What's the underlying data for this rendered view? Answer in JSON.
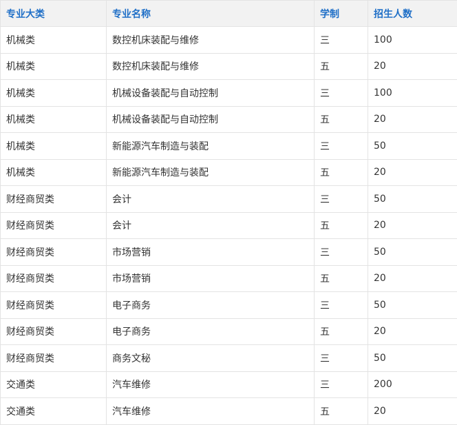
{
  "table": {
    "headers": [
      "专业大类",
      "专业名称",
      "学制",
      "招生人数"
    ],
    "rows": [
      [
        "机械类",
        "数控机床装配与维修",
        "三",
        "100"
      ],
      [
        "机械类",
        "数控机床装配与维修",
        "五",
        "20"
      ],
      [
        "机械类",
        "机械设备装配与自动控制",
        "三",
        "100"
      ],
      [
        "机械类",
        "机械设备装配与自动控制",
        "五",
        "20"
      ],
      [
        "机械类",
        "新能源汽车制造与装配",
        "三",
        "50"
      ],
      [
        "机械类",
        "新能源汽车制造与装配",
        "五",
        "20"
      ],
      [
        "财经商贸类",
        "会计",
        "三",
        "50"
      ],
      [
        "财经商贸类",
        "会计",
        "五",
        "20"
      ],
      [
        "财经商贸类",
        "市场营销",
        "三",
        "50"
      ],
      [
        "财经商贸类",
        "市场营销",
        "五",
        "20"
      ],
      [
        "财经商贸类",
        "电子商务",
        "三",
        "50"
      ],
      [
        "财经商贸类",
        "电子商务",
        "五",
        "20"
      ],
      [
        "财经商贸类",
        "商务文秘",
        "三",
        "50"
      ],
      [
        "交通类",
        "汽车维修",
        "三",
        "200"
      ],
      [
        "交通类",
        "汽车维修",
        "五",
        "20"
      ]
    ]
  },
  "colors": {
    "header_text": "#1f6fc7",
    "header_background": "#f2f2f2",
    "border": "#e3e3e3",
    "body_text": "#333333"
  }
}
